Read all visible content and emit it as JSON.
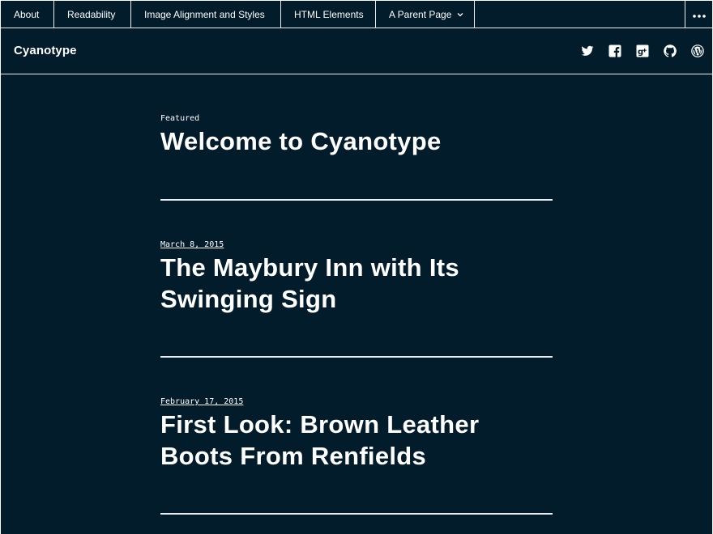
{
  "nav": {
    "items": [
      {
        "label": "About"
      },
      {
        "label": "Readability"
      },
      {
        "label": "Image Alignment and Styles"
      },
      {
        "label": "HTML Elements"
      },
      {
        "label": "A Parent Page"
      }
    ],
    "more_icon": "ellipsis-icon",
    "dropdown_icon": "chevron-down-icon"
  },
  "site": {
    "title": "Cyanotype"
  },
  "social": [
    "twitter-icon",
    "facebook-icon",
    "google-plus-icon",
    "github-icon",
    "wordpress-icon"
  ],
  "posts": [
    {
      "meta": "Featured",
      "title": "Welcome to Cyanotype"
    },
    {
      "meta": "March 8, 2015",
      "title": "The Maybury Inn with Its Swinging Sign"
    },
    {
      "meta": "February 17, 2015",
      "title": "First Look: Brown Leather Boots From Renfields"
    }
  ],
  "colors": {
    "background": "#021c2b",
    "text": "#ffffff",
    "border": "#e8eef2"
  }
}
